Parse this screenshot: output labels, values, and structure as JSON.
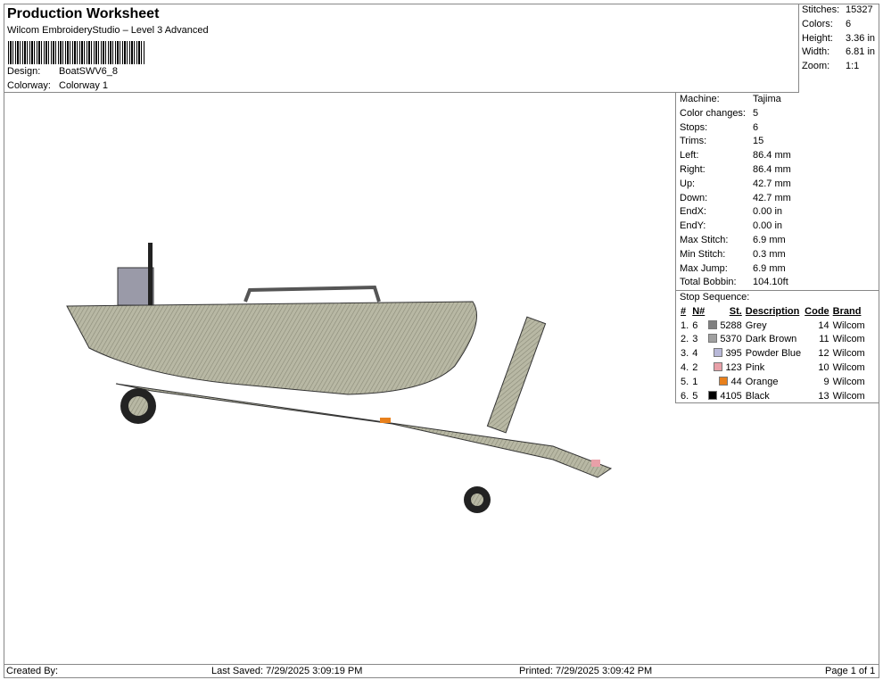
{
  "header": {
    "title": "Production Worksheet",
    "subtitle": "Wilcom EmbroideryStudio – Level 3 Advanced",
    "design_label": "Design:",
    "design": "BoatSWV6_8",
    "colorway_label": "Colorway:",
    "colorway": "Colorway 1"
  },
  "stats": [
    {
      "k": "Stitches:",
      "v": "15327"
    },
    {
      "k": "Colors:",
      "v": "6"
    },
    {
      "k": "Height:",
      "v": "3.36 in"
    },
    {
      "k": "Width:",
      "v": "6.81 in"
    },
    {
      "k": "Zoom:",
      "v": "1:1"
    }
  ],
  "info": [
    {
      "k": "Machine:",
      "v": "Tajima"
    },
    {
      "k": "Color changes:",
      "v": "5"
    },
    {
      "k": "Stops:",
      "v": "6"
    },
    {
      "k": "Trims:",
      "v": "15"
    },
    {
      "k": "Left:",
      "v": "86.4 mm"
    },
    {
      "k": "Right:",
      "v": "86.4 mm"
    },
    {
      "k": "Up:",
      "v": "42.7 mm"
    },
    {
      "k": "Down:",
      "v": "42.7 mm"
    },
    {
      "k": "EndX:",
      "v": "0.00 in"
    },
    {
      "k": "EndY:",
      "v": "0.00 in"
    },
    {
      "k": "Max Stitch:",
      "v": "6.9 mm"
    },
    {
      "k": "Min Stitch:",
      "v": "0.3 mm"
    },
    {
      "k": "Max Jump:",
      "v": "6.9 mm"
    },
    {
      "k": "Total Bobbin:",
      "v": "104.10ft"
    }
  ],
  "stop_sequence": {
    "label": "Stop Sequence:",
    "headers": [
      "#",
      "N#",
      "St.",
      "Description",
      "Code",
      "Brand"
    ],
    "rows": [
      {
        "i": "1.",
        "n": "6",
        "color": "#808080",
        "st": "5288",
        "desc": "Grey",
        "code": "14",
        "brand": "Wilcom"
      },
      {
        "i": "2.",
        "n": "3",
        "color": "#a0a0a0",
        "st": "5370",
        "desc": "Dark Brown",
        "code": "11",
        "brand": "Wilcom"
      },
      {
        "i": "3.",
        "n": "4",
        "color": "#b8b8d8",
        "st": "395",
        "desc": "Powder Blue",
        "code": "12",
        "brand": "Wilcom"
      },
      {
        "i": "4.",
        "n": "2",
        "color": "#e8a0a8",
        "st": "123",
        "desc": "Pink",
        "code": "10",
        "brand": "Wilcom"
      },
      {
        "i": "5.",
        "n": "1",
        "color": "#e8801c",
        "st": "44",
        "desc": "Orange",
        "code": "9",
        "brand": "Wilcom"
      },
      {
        "i": "6.",
        "n": "5",
        "color": "#000000",
        "st": "4105",
        "desc": "Black",
        "code": "13",
        "brand": "Wilcom"
      }
    ]
  },
  "footer": {
    "created": "Created By:",
    "saved": "Last Saved: 7/29/2025 3:09:19 PM",
    "printed": "Printed: 7/29/2025 3:09:42 PM",
    "page": "Page 1 of 1"
  }
}
